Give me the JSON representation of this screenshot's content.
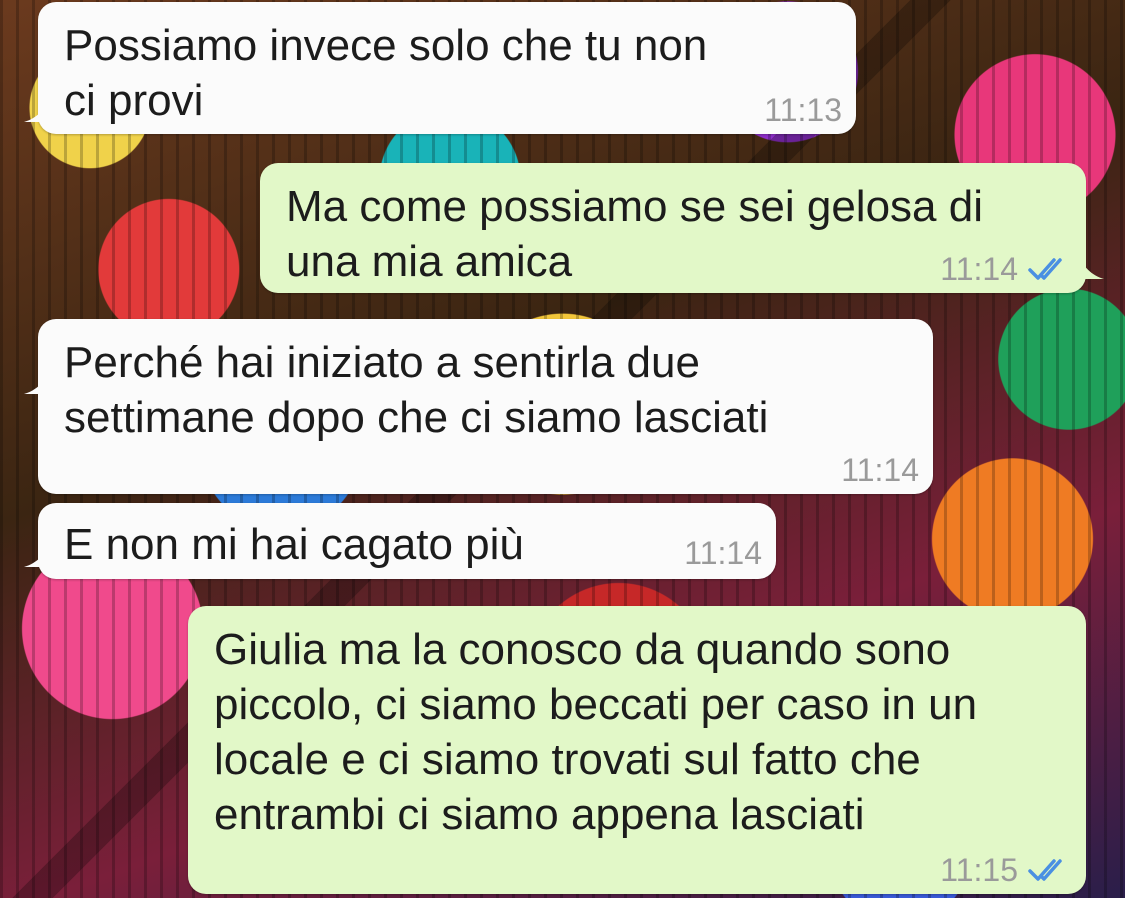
{
  "messages": [
    {
      "direction": "in",
      "text": "Possiamo invece solo che tu non\nci provi",
      "time": "11:13",
      "read_receipt": false
    },
    {
      "direction": "out",
      "text": "Ma come possiamo se sei gelosa di\nuna mia amica",
      "time": "11:14",
      "read_receipt": true
    },
    {
      "direction": "in",
      "text": "Perché hai iniziato a sentirla due\nsettimane dopo che ci siamo lasciati",
      "time": "11:14",
      "read_receipt": false
    },
    {
      "direction": "in",
      "text": "E non mi hai cagato più",
      "time": "11:14",
      "read_receipt": false
    },
    {
      "direction": "out",
      "text": "Giulia ma la conosco da quando sono\npiccolo, ci siamo beccati per caso in un\nlocale e ci siamo trovati sul fatto che\nentrambi ci siamo appena lasciati",
      "time": "11:15",
      "read_receipt": true
    }
  ],
  "colors": {
    "incoming_bubble": "#fbfbfb",
    "outgoing_bubble": "#e2f8c8",
    "timestamp": "#9a9a9a",
    "read_ticks": "#4a90e2"
  },
  "icons": {
    "read_receipt": "double-check-icon"
  }
}
